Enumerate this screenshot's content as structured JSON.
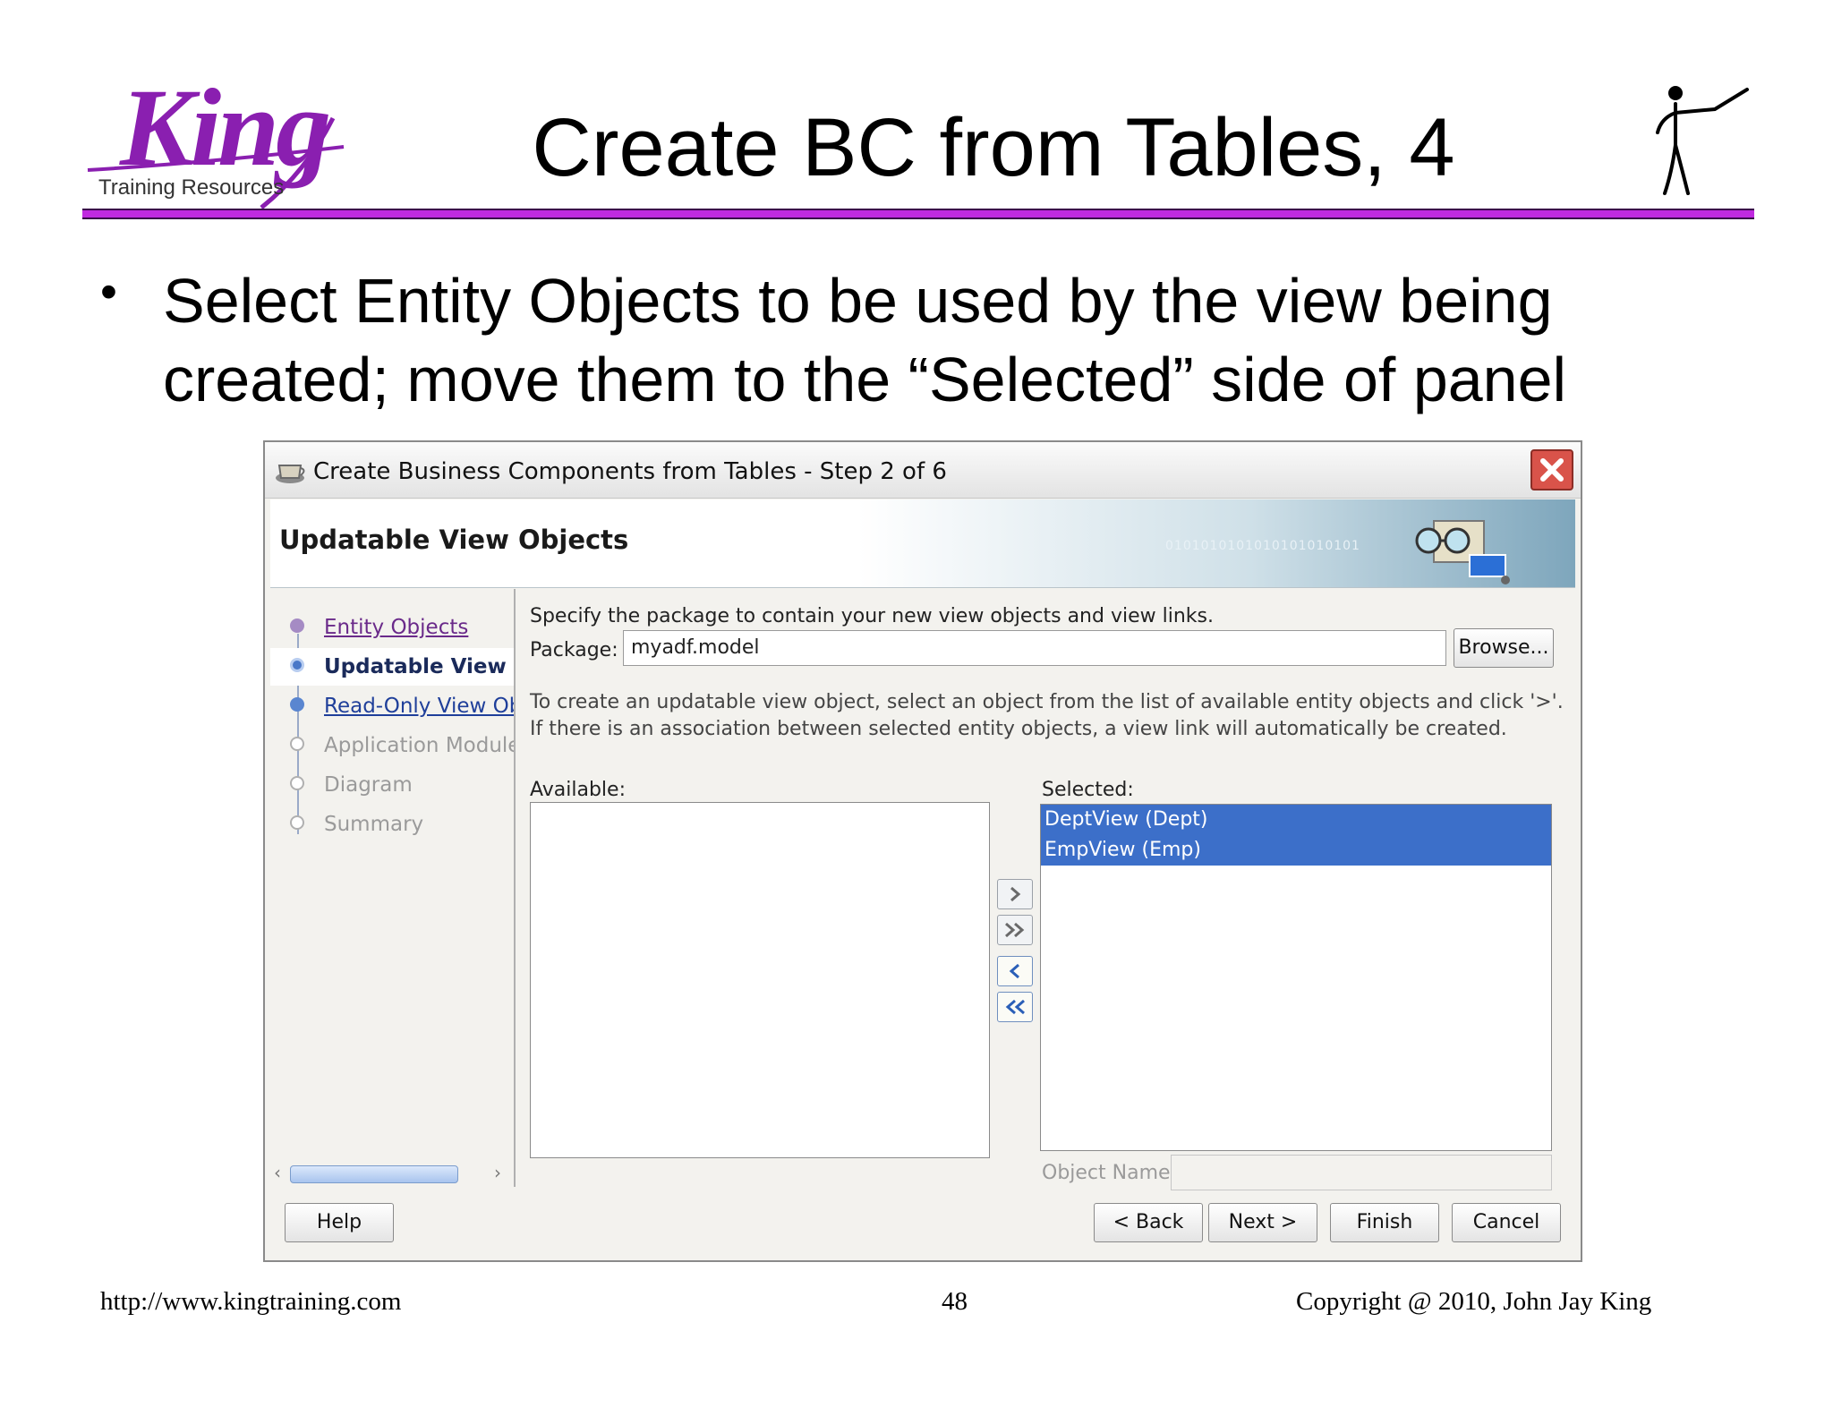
{
  "slide": {
    "logo_text": "King",
    "logo_subtext": "Training Resources",
    "title": "Create BC from Tables, 4",
    "bullet": "Select Entity Objects to be used by the view being created; move them to the “Selected” side of panel"
  },
  "dialog": {
    "title": "Create Business Components from Tables - Step 2 of 6",
    "banner_title": "Updatable View Objects",
    "banner_bits": "0101010101010101010101",
    "nav": [
      {
        "label": "Entity Objects",
        "state": "visited"
      },
      {
        "label": "Updatable View Objects",
        "state": "current"
      },
      {
        "label": "Read-Only View Objects",
        "state": "link"
      },
      {
        "label": "Application Module",
        "state": "disabled"
      },
      {
        "label": "Diagram",
        "state": "disabled"
      },
      {
        "label": "Summary",
        "state": "disabled"
      }
    ],
    "package_note": "Specify the package to contain your new view objects and view links.",
    "package_label": "Package:",
    "package_value": "myadf.model",
    "browse_label": "Browse...",
    "hint": "To create an updatable view object, select an object from the list of available entity objects and click '>'.  If there is an association between selected entity objects, a view link will automatically be created.",
    "available_label": "Available:",
    "available_items": [],
    "selected_label": "Selected:",
    "selected_items": [
      "DeptView (Dept)",
      "EmpView (Emp)"
    ],
    "object_name_label": "Object Name:",
    "object_name_value": "",
    "buttons": {
      "help": "Help",
      "back": "< Back",
      "next": "Next >",
      "finish": "Finish",
      "cancel": "Cancel"
    },
    "colors": {
      "selection": "#3c6fc9",
      "accent_rule": "#c02ae0",
      "logo": "#8a1fb0"
    }
  },
  "footer": {
    "url": "http://www.kingtraining.com",
    "page": "48",
    "copyright": "Copyright @ 2010, John Jay King"
  }
}
